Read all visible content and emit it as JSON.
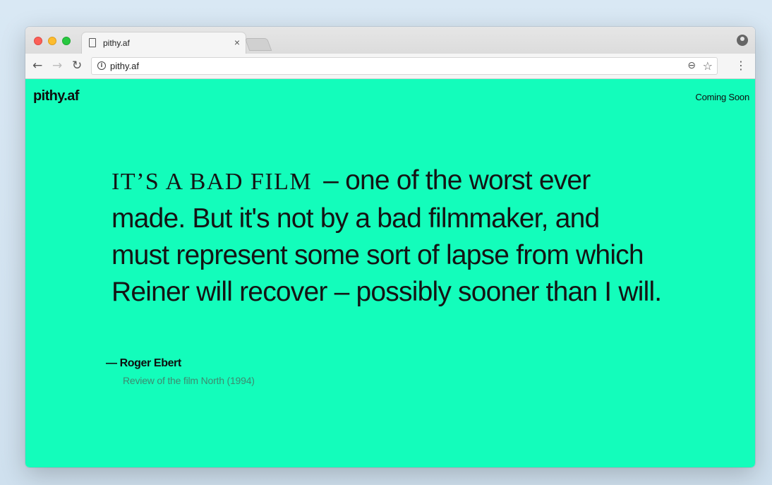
{
  "browser": {
    "tab": {
      "title": "pithy.af",
      "close_label": "×"
    },
    "address_bar": {
      "url": "pithy.af"
    },
    "icons": {
      "back": "back-arrow-icon",
      "forward": "forward-arrow-icon",
      "reload": "reload-icon",
      "info": "info-icon",
      "zoom": "zoom-icon",
      "bookmark": "star-icon",
      "menu": "kebab-menu-icon",
      "profile": "profile-icon"
    }
  },
  "page": {
    "background_color": "#13fdbb",
    "logo": "pithy.af",
    "nav_right": "Coming Soon",
    "quote": {
      "lead": "IT’S A BAD FILM",
      "body": " – one of the worst ever made. But it's not by a bad filmmaker, and must represent some sort of lapse from which Reiner will recover – possibly sooner than I will."
    },
    "attribution": {
      "author": "— Roger Ebert",
      "source": "Review of the film North (1994)"
    }
  }
}
